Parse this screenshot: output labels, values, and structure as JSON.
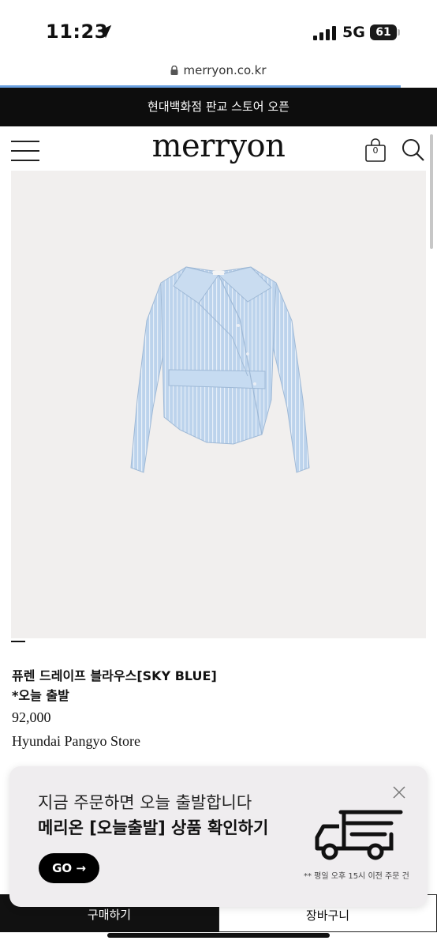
{
  "status_bar": {
    "time": "11:23",
    "network": "5G",
    "battery": "61"
  },
  "url": {
    "domain": "merryon.co.kr"
  },
  "announcement": {
    "text": "현대백화점 판교 스토어 오픈"
  },
  "header": {
    "logo": "merryon",
    "cart_count": "0"
  },
  "product": {
    "name": "퓨렌 드레이프 블라우스[SKY BLUE]",
    "tag": "*오늘 출발",
    "price": "92,000",
    "store": "Hyundai Pangyo Store",
    "image_colors": {
      "background": "#f1efee",
      "shirt": "#bcd3ec",
      "stripe": "#e8f0f9"
    }
  },
  "popup": {
    "line1": "지금 주문하면 오늘 출발합니다",
    "line2": "메리온 [오늘출발] 상품 확인하기",
    "go_label": "GO →",
    "note": "** 평일 오후 15시 이전 주문 건"
  },
  "bottom_bar": {
    "buy_label": "구매하기",
    "cart_label": "장바구니"
  }
}
